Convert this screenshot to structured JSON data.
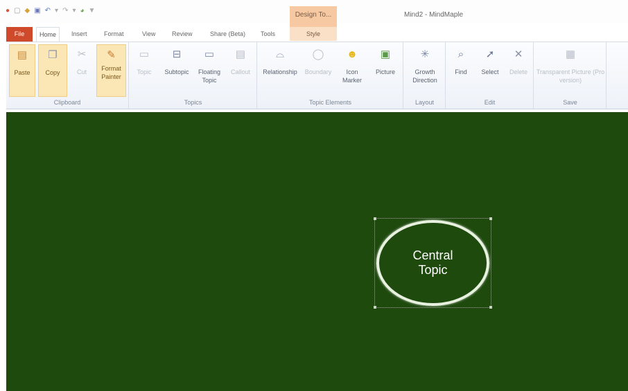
{
  "window": {
    "title": "Mind2 - MindMaple"
  },
  "quick_access": [
    "app-logo-icon",
    "new-icon",
    "open-icon",
    "save-icon",
    "undo-icon",
    "redo-icon",
    "customize-icon"
  ],
  "contextual": {
    "header": "Design To...",
    "tab": "Style"
  },
  "tabs": {
    "file": "File",
    "items": [
      "Home",
      "Insert",
      "Format",
      "View",
      "Review",
      "Share (Beta)",
      "Tools"
    ],
    "active": "Home"
  },
  "ribbon": {
    "clipboard": {
      "label": "Clipboard",
      "paste": "Paste",
      "copy": "Copy",
      "cut": "Cut",
      "format_painter": "Format Painter"
    },
    "topics": {
      "label": "Topics",
      "topic": "Topic",
      "subtopic": "Subtopic",
      "floating_topic": "Floating Topic",
      "callout": "Callout"
    },
    "topic_elements": {
      "label": "Topic Elements",
      "relationship": "Relationship",
      "boundary": "Boundary",
      "icon_marker": "Icon Marker",
      "picture": "Picture"
    },
    "layout": {
      "label": "Layout",
      "growth_direction": "Growth Direction"
    },
    "edit": {
      "label": "Edit",
      "find": "Find",
      "select": "Select",
      "delete": "Delete"
    },
    "save": {
      "label": "Save",
      "transparent_picture": "Transparent Picture (Pro version)"
    }
  },
  "canvas": {
    "background": "#1e4a0e",
    "central_topic": "Central Topic"
  },
  "colors": {
    "file_tab": "#cf4a2a",
    "contextual": "#f7c9a2",
    "highlight": "#fbe6b5"
  }
}
